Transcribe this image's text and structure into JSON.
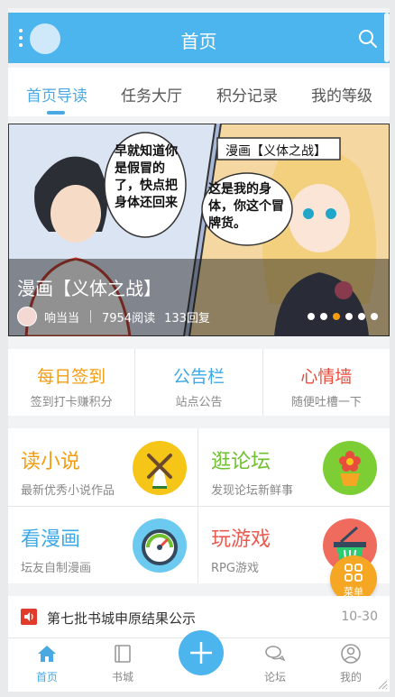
{
  "header": {
    "title": "首页",
    "menu_icon": "more-vertical-icon",
    "search_icon": "search-icon"
  },
  "tabs": [
    {
      "label": "首页导读",
      "active": true
    },
    {
      "label": "任务大厅"
    },
    {
      "label": "积分记录"
    },
    {
      "label": "我的等级"
    }
  ],
  "banner": {
    "caption": "漫画【义体之战】",
    "bubble_tag": "漫画【义体之战】",
    "bubble_left": "早就知道你是假冒的了，快点把身体还回来",
    "bubble_right": "这是我的身体，你这个冒牌货。",
    "author": "响当当",
    "reads": "7954阅读",
    "replies": "133回复",
    "slides": 6,
    "current_slide": 3
  },
  "quick": [
    {
      "title": "每日签到",
      "sub": "签到打卡赚积分",
      "color": "#f39c12"
    },
    {
      "title": "公告栏",
      "sub": "站点公告",
      "color": "#3ea8e8"
    },
    {
      "title": "心情墙",
      "sub": "随便吐槽一下",
      "color": "#e74c3c"
    }
  ],
  "grid": [
    {
      "title": "读小说",
      "sub": "最新优秀小说作品",
      "color": "#f39c12",
      "icon": "windmill-icon",
      "icon_bg": "#f5c518"
    },
    {
      "title": "逛论坛",
      "sub": "发现论坛新鲜事",
      "color": "#6fc12f",
      "icon": "flower-pot-icon",
      "icon_bg": "#7dce34"
    },
    {
      "title": "看漫画",
      "sub": "坛友自制漫画",
      "color": "#3ea8e8",
      "icon": "gauge-icon",
      "icon_bg": "#6ccaf0"
    },
    {
      "title": "玩游戏",
      "sub": "RPG游戏",
      "color": "#ea5a4e",
      "icon": "basket-icon",
      "icon_bg": "#ef6b5e"
    }
  ],
  "fab_menu": {
    "label": "菜单",
    "icon": "grid-icon"
  },
  "notice": {
    "text": "第七批书城申原结果公示",
    "date": "10-30",
    "icon": "speaker-icon"
  },
  "bottom_nav": [
    {
      "label": "首页",
      "icon": "home-icon",
      "active": true
    },
    {
      "label": "书城",
      "icon": "book-icon"
    },
    {
      "label": "论坛",
      "icon": "chat-icon"
    },
    {
      "label": "我的",
      "icon": "user-icon"
    }
  ],
  "colors": {
    "primary": "#4db5ee",
    "accent": "#4aa8e3",
    "orange": "#f39c12"
  }
}
